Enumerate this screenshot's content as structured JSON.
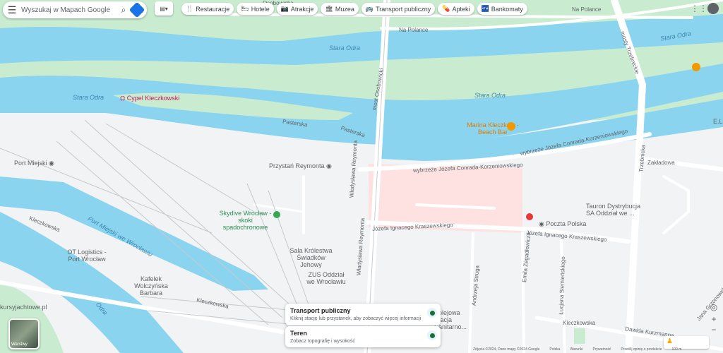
{
  "search": {
    "placeholder": "Wyszukaj w Mapach Google",
    "menu_icon": "menu-icon",
    "search_icon": "search-icon",
    "directions_icon": "directions-icon"
  },
  "layer_toggle": {
    "icon": "layers-icon"
  },
  "chips": [
    {
      "label": "Restauracje",
      "icon": "restaurant-icon",
      "glyph": "🍴"
    },
    {
      "label": "Hotele",
      "icon": "hotel-icon",
      "glyph": "🛏"
    },
    {
      "label": "Atrakcje",
      "icon": "camera-icon",
      "glyph": "📷"
    },
    {
      "label": "Muzea",
      "icon": "museum-icon",
      "glyph": "🏛"
    },
    {
      "label": "Transport publiczny",
      "icon": "bus-icon",
      "glyph": "🚌"
    },
    {
      "label": "Apteki",
      "icon": "pharmacy-icon",
      "glyph": "💊"
    },
    {
      "label": "Bankomaty",
      "icon": "atm-icon",
      "glyph": "🏧"
    }
  ],
  "labels": {
    "water": [
      "Stara Odra",
      "Stara Odra",
      "Stara Odra",
      "Stara Odra",
      "Odra",
      "Port Miejski we Wrocławiu"
    ],
    "streets": [
      "Osobowicka",
      "Na Polance",
      "Na Polance",
      "most Osobowicki",
      "mosty Trzebnickie",
      "Pasterska",
      "Pasterska",
      "Władysława Reymonta",
      "Władysława Reymonta",
      "wybrzeże Józefa Conrada-Korzeniowskiego",
      "wybrzeże Józefa Conrada-Korzeniowskiego",
      "Zakładowa",
      "Trzebnicka",
      "Józefa Ignacego Kraszewskiego",
      "Józefa Ignacego Kraszewskiego",
      "Emila Zegadłowicza",
      "Andrzeja Struga",
      "Łucjana Siemieńskiego",
      "Kleczkowska",
      "Kleczkowska",
      "Kleczkowska",
      "Dawida Kurzmanna",
      "Jana Grzonowskiego"
    ],
    "pois": {
      "cypel": "Cypel Kleczkowski",
      "marina": "Marina Kleczków - Beach Bar",
      "port": "Port Miejski",
      "przystan": "Przystań Reymonta",
      "skydive": "Skydive Wrocław - skoki spadochronowe",
      "sala": "Sala Królestwa Świadków Jehowy",
      "zus": "ZUS Oddział we Wrocławiu",
      "poczta": "Poczta Polska",
      "tauron": "Tauron Dystrybucja SA Oddział we ...",
      "otlogistics": "OT Logistics - Port Wrocław",
      "kafelek": "Kafelek Wolczyńska Barbara",
      "kursy": "kursyjachtowe.pl",
      "stacja": "Kolejowa Stacja Sanitarno...",
      "edge": "E.Le"
    }
  },
  "cards": [
    {
      "title": "Transport publiczny",
      "subtitle": "Kliknij stację lub przystanek, aby zobaczyć więcej informacji"
    },
    {
      "title": "Teren",
      "subtitle": "Zobacz topografię i wysokość"
    }
  ],
  "layers_button": {
    "label": "Warstwy"
  },
  "footer": [
    "Zdjęcia ©2024, Dane mapy ©2024 Google",
    "Polska",
    "Warunki",
    "Prywatność",
    "Prześlij opinię o produkcie",
    "100 m"
  ],
  "colors": {
    "water": "#8ad4f0",
    "land": "#f1f3f4",
    "green": "#c9ecd0",
    "road": "#ffffff",
    "highlight": "#fde2e1",
    "accent": "#1a73e8"
  }
}
